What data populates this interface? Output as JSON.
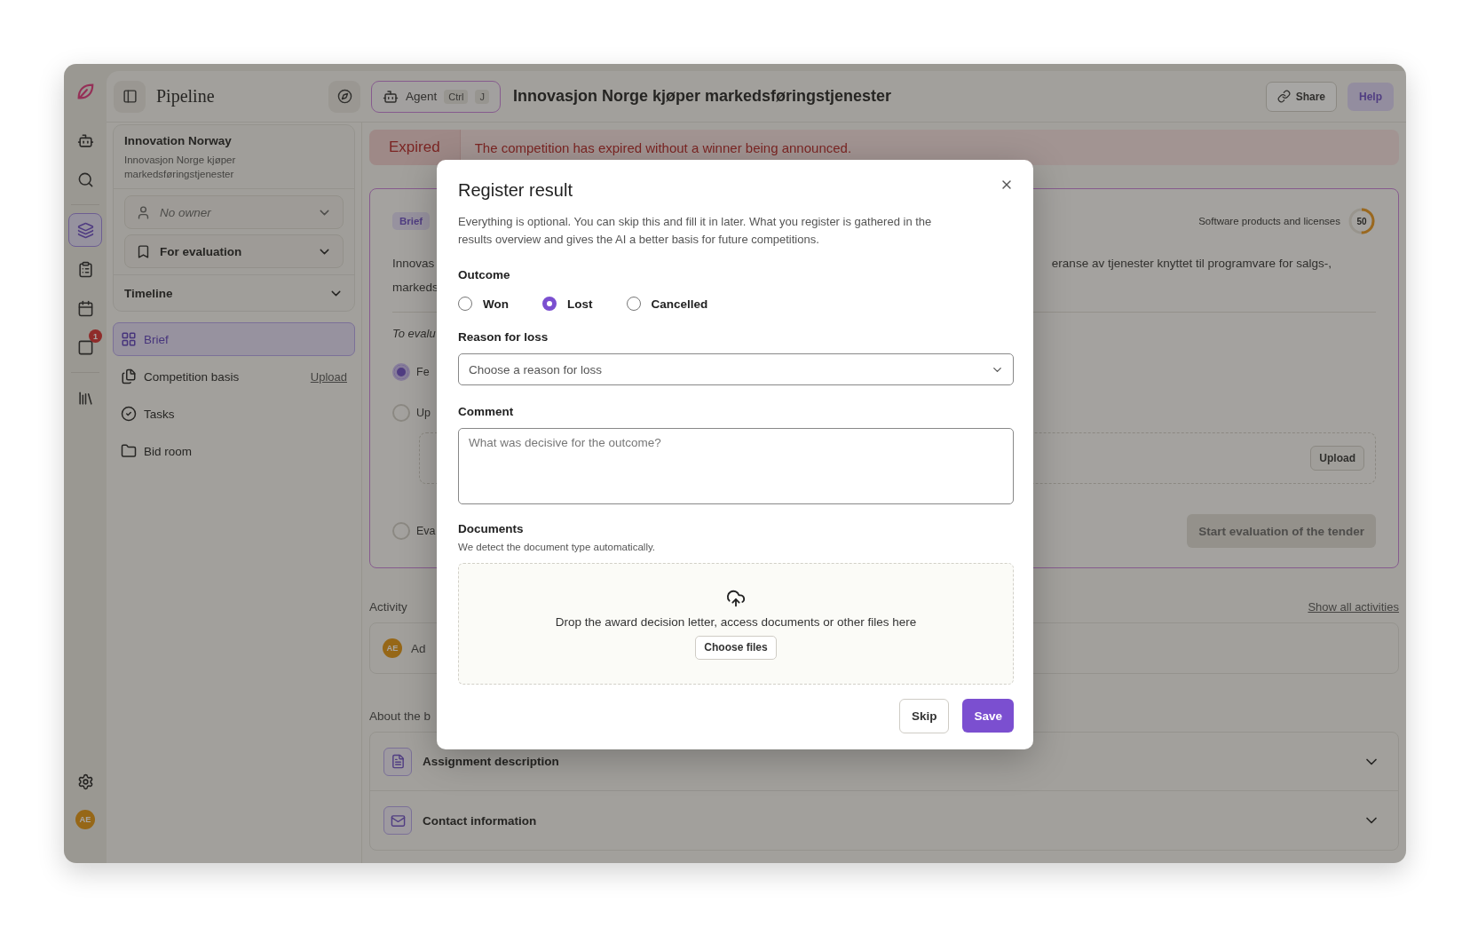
{
  "rail": {
    "items": [
      {
        "kind": "robot",
        "selected": false
      },
      {
        "kind": "search",
        "selected": false
      },
      {
        "kind": "layers",
        "selected": true
      },
      {
        "kind": "clipboard",
        "selected": false
      },
      {
        "kind": "calendar",
        "selected": false
      },
      {
        "kind": "inbox",
        "selected": false,
        "badge": "1"
      },
      {
        "kind": "library",
        "selected": false
      }
    ],
    "avatar": "AE"
  },
  "topbar": {
    "title": "Pipeline",
    "agent": {
      "label": "Agent",
      "keys": [
        "Ctrl",
        "J"
      ]
    },
    "page_title": "Innovasjon Norge kjøper markedsføringstjenester",
    "share": "Share",
    "help": "Help"
  },
  "sidebar": {
    "org": "Innovation Norway",
    "subtitle": "Innovasjon Norge kjøper markedsføringstjenester",
    "owner": "No owner",
    "status": "For evaluation",
    "timeline": {
      "label": "Timeline",
      "expanded": false
    },
    "nav": [
      {
        "kind": "grid",
        "label": "Brief",
        "selected": true
      },
      {
        "kind": "files",
        "label": "Competition basis",
        "selected": false,
        "action": "Upload"
      },
      {
        "kind": "check",
        "label": "Tasks",
        "selected": false
      },
      {
        "kind": "folder",
        "label": "Bid room",
        "selected": false
      }
    ]
  },
  "banner": {
    "status": "Expired",
    "message": "The competition has expired without a winner being announced."
  },
  "brief": {
    "tag": "Brief",
    "category": "Software products and licenses",
    "score": "50",
    "level": 0.5,
    "lines_left": [
      "Innovas",
      "markeds"
    ],
    "line_right": "eranse av tjenester knyttet til programvare for salgs-,",
    "section": "To evalu",
    "steps": [
      {
        "label": "Fe",
        "done": true
      },
      {
        "label": "Up",
        "done": false
      },
      {
        "label": "Eva",
        "done": false
      }
    ],
    "upload": "Upload",
    "start": "Start evaluation of the tender"
  },
  "activity": {
    "label": "Activity",
    "link": "Show all activities",
    "rows": [
      {
        "initials": "AE",
        "text": "Ad"
      }
    ]
  },
  "about": {
    "label": "About the b",
    "sections": [
      {
        "kind": "document",
        "label": "Assignment description",
        "expanded": false
      },
      {
        "kind": "mail",
        "label": "Contact information",
        "expanded": false
      }
    ]
  },
  "modal": {
    "title": "Register result",
    "description": "Everything is optional. You can skip this and fill it in later. What you register is gathered in the results overview and gives the AI a better basis for future competitions.",
    "outcome": {
      "label": "Outcome",
      "options": [
        {
          "label": "Won",
          "selected": false
        },
        {
          "label": "Lost",
          "selected": true
        },
        {
          "label": "Cancelled",
          "selected": false
        }
      ]
    },
    "reason": {
      "label": "Reason for loss",
      "placeholder": "Choose a reason for loss"
    },
    "comment": {
      "label": "Comment",
      "placeholder": "What was decisive for the outcome?"
    },
    "documents": {
      "label": "Documents",
      "hint": "We detect the document type automatically.",
      "drop_text": "Drop the award decision letter, access documents or other files here",
      "choose": "Choose files"
    },
    "skip": "Skip",
    "save": "Save"
  }
}
